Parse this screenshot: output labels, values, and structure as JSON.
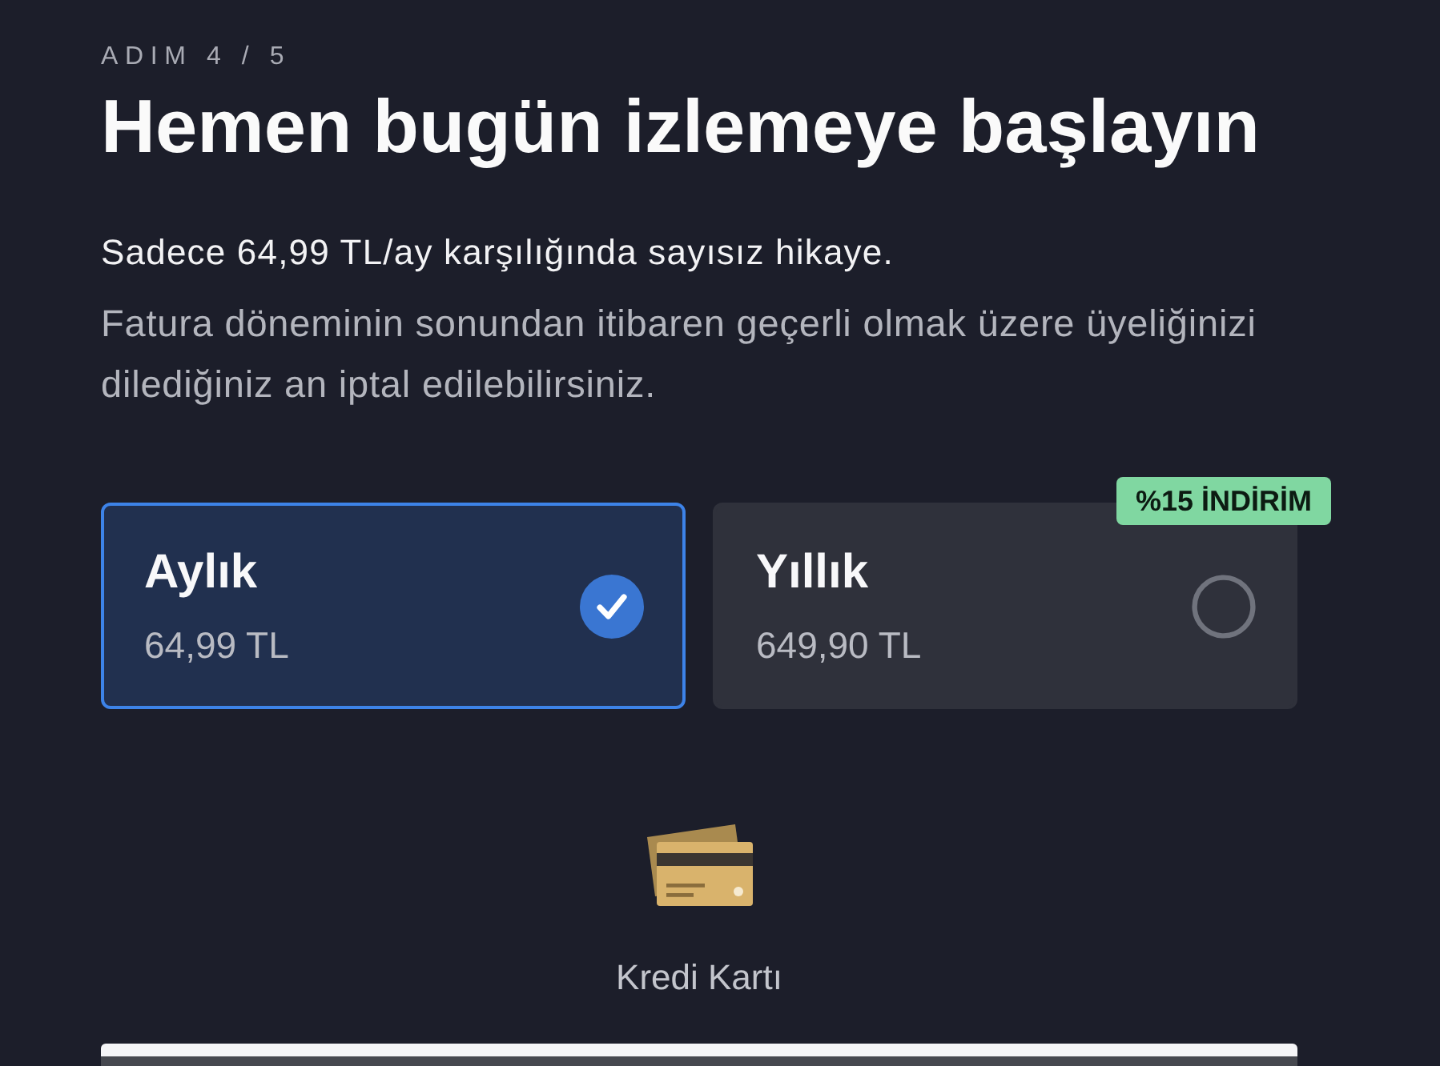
{
  "step": {
    "label": "ADIM 4 / 5"
  },
  "title": "Hemen bugün izlemeye başlayın",
  "summary": "Sadece 64,99 TL/ay karşılığında sayısız hikaye.",
  "note": "Fatura döneminin sonundan itibaren geçerli olmak üzere üyeliğinizi dilediğiniz an iptal edilebilirsiniz.",
  "plans": [
    {
      "name": "Aylık",
      "price": "64,99 TL",
      "selected": true
    },
    {
      "name": "Yıllık",
      "price": "649,90 TL",
      "selected": false,
      "badge": "%15 İNDİRİM"
    }
  ],
  "payment_methods": [
    {
      "label": "Kredi Kartı"
    }
  ]
}
